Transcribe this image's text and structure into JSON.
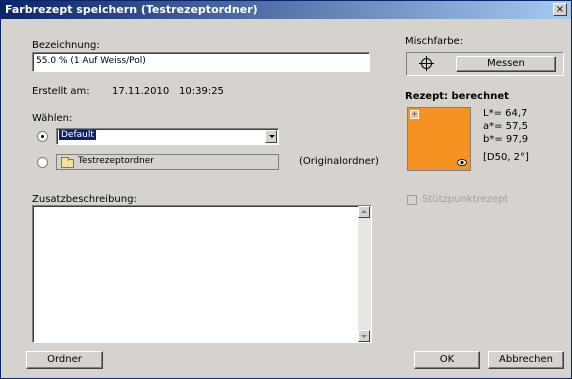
{
  "window": {
    "title": "Farbrezept speichern (Testrezeptordner)",
    "close": "×"
  },
  "bezeichnung": {
    "label": "Bezeichnung:",
    "value": "55.0 %  (1 Auf Weiss/Pol)"
  },
  "erstellt": {
    "label": "Erstellt am:",
    "date": "17.11.2010",
    "time": "10:39:25"
  },
  "waehlen": {
    "label": "Wählen:",
    "option1": "Default",
    "option2": "Testrezeptordner",
    "original": "(Originalordner)"
  },
  "zusatz": {
    "label": "Zusatzbeschreibung:",
    "value": ""
  },
  "mischfarbe": {
    "label": "Mischfarbe:",
    "messen": "Messen"
  },
  "rezept": {
    "label": "Rezept: berechnet",
    "color": "#f59222",
    "L": "L*=  64,7",
    "a": "a*=  57,5",
    "b": "b*=  97,9",
    "illum": "[D50, 2°]"
  },
  "stuetzpunkt": {
    "label": "Stützpunktrezept",
    "checked": false
  },
  "buttons": {
    "ordner": "Ordner",
    "ok": "OK",
    "abbrechen": "Abbrechen"
  }
}
